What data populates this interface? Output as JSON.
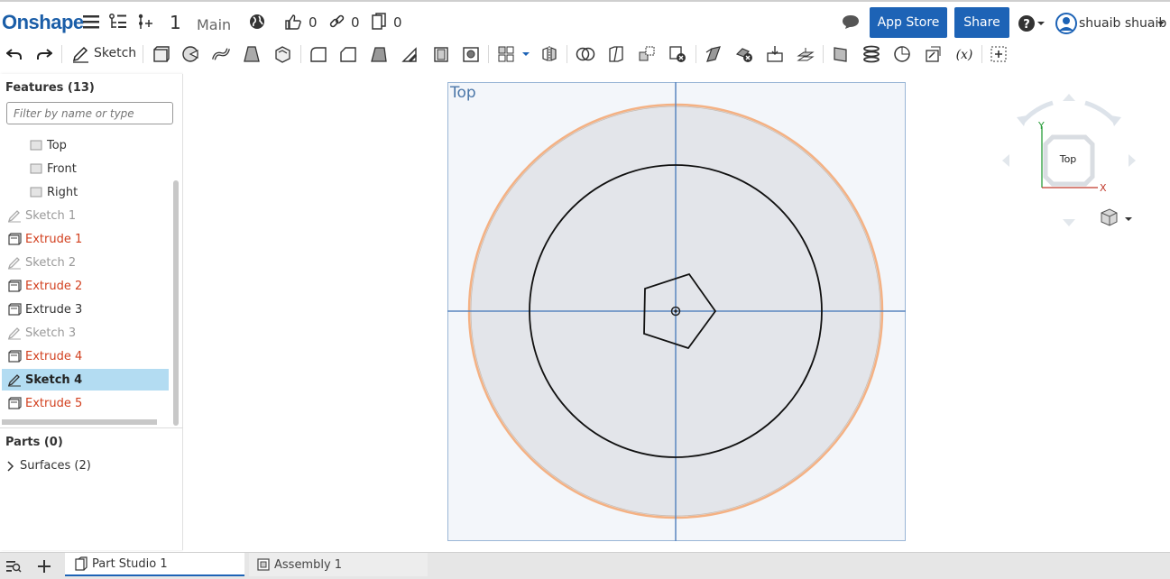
{
  "app": {
    "logo": "Onshape",
    "version": "1",
    "branch": "Main"
  },
  "header": {
    "likes": "0",
    "links": "0",
    "copies": "0",
    "app_store": "App Store",
    "share": "Share",
    "user": "shuaib shuaib"
  },
  "toolbar": {
    "sketch_label": "Sketch"
  },
  "features": {
    "title": "Features (13)",
    "filter_placeholder": "Filter by name or type",
    "items": [
      {
        "label": "Top",
        "kind": "plane"
      },
      {
        "label": "Front",
        "kind": "plane"
      },
      {
        "label": "Right",
        "kind": "plane"
      },
      {
        "label": "Sketch 1",
        "kind": "sketch"
      },
      {
        "label": "Extrude 1",
        "kind": "extrude"
      },
      {
        "label": "Sketch 2",
        "kind": "sketch"
      },
      {
        "label": "Extrude 2",
        "kind": "extrude"
      },
      {
        "label": "Extrude 3",
        "kind": "extrude"
      },
      {
        "label": "Sketch 3",
        "kind": "sketch"
      },
      {
        "label": "Extrude 4",
        "kind": "extrude"
      },
      {
        "label": "Sketch 4",
        "kind": "sketch",
        "selected": true
      },
      {
        "label": "Extrude 5",
        "kind": "extrude"
      }
    ]
  },
  "parts": {
    "title": "Parts (0)",
    "surfaces": "Surfaces (2)"
  },
  "viewport": {
    "plane_label": "Top"
  },
  "viewcube": {
    "face": "Top",
    "axis_x": "X",
    "axis_y": "Y"
  },
  "tabs": {
    "part_studio": "Part Studio 1",
    "assembly": "Assembly 1"
  },
  "colors": {
    "accent": "#1d63b6",
    "error_feature": "#d2401f",
    "selected_row": "#b3dcf2",
    "sketch_plane": "#f3f6fa",
    "highlight_edge": "#f4b183"
  }
}
